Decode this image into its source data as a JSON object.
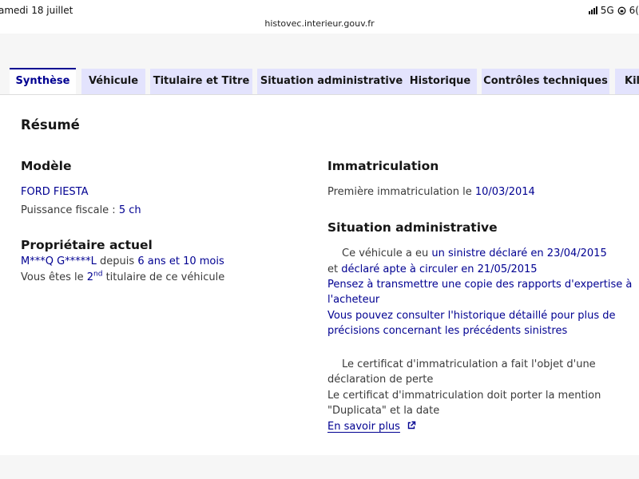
{
  "status_bar": {
    "date": "amedi 18 juillet",
    "network": "5G",
    "battery_partial": "6("
  },
  "browser": {
    "url": "histovec.interieur.gouv.fr"
  },
  "tabs": [
    {
      "label": "Synthèse"
    },
    {
      "label": "Véhicule"
    },
    {
      "label": "Titulaire et Titre"
    },
    {
      "label": "Situation administrative"
    },
    {
      "label": "Historique"
    },
    {
      "label": "Contrôles techniques"
    },
    {
      "label": "Kil"
    }
  ],
  "summary": {
    "title": "Résumé",
    "model": {
      "heading": "Modèle",
      "name": "FORD FIESTA",
      "fiscal_power_label": "Puissance fiscale :",
      "fiscal_power_value": "5 ch"
    },
    "owner": {
      "heading": "Propriétaire actuel",
      "name": "M***Q G*****L",
      "since_label": "depuis",
      "since_value": "6 ans et 10 mois",
      "rank_prefix": "Vous êtes le",
      "rank_number": "2",
      "rank_suffix": "nd",
      "rank_end": "titulaire de ce véhicule"
    },
    "registration": {
      "heading": "Immatriculation",
      "first_label": "Première immatriculation le",
      "first_date": "10/03/2014"
    },
    "admin": {
      "heading": "Situation administrative",
      "accident_prefix": "Ce véhicule a eu",
      "accident_link": "un sinistre déclaré en 23/04/2015",
      "fit_prefix": "et",
      "fit_link": "déclaré apte à circuler en 21/05/2015",
      "advice_1a": "Pensez à transmettre une copie des rapports d'expertise à",
      "advice_1b": "l'acheteur",
      "advice_2a": "Vous pouvez consulter l'historique détaillé pour plus de",
      "advice_2b": "précisions concernant les précédents sinistres",
      "loss_1a": "Le certificat d'immatriculation a fait l'objet d'une",
      "loss_1b": "déclaration de perte",
      "loss_2a": "Le certificat d'immatriculation doit porter la mention",
      "loss_2b": "\"Duplicata\" et la date",
      "learn_more": "En savoir plus"
    }
  },
  "colors": {
    "brand_blue": "#000091",
    "tab_bg": "#e3e3fd",
    "text": "#3a3a3a"
  },
  "icons": {
    "external_link": "external-link-icon",
    "signal": "cellular-signal-icon"
  }
}
